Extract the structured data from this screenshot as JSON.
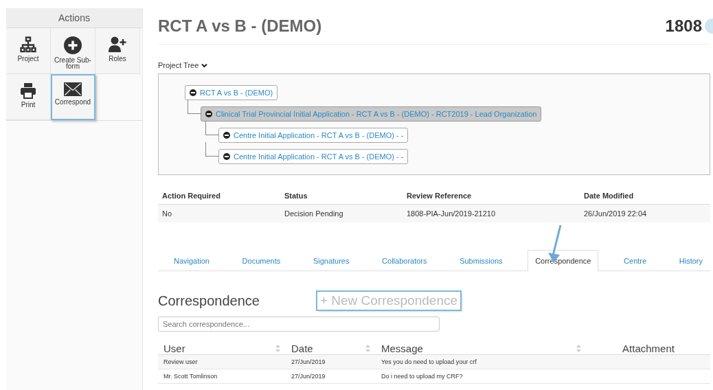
{
  "sidebar": {
    "title": "Actions",
    "actions": [
      {
        "label": "Project",
        "kind": "hierarchy",
        "highlighted": false
      },
      {
        "label": "Create Sub-form",
        "kind": "plus",
        "highlighted": false
      },
      {
        "label": "Roles",
        "kind": "adduser",
        "highlighted": false
      },
      {
        "label": "Print",
        "kind": "printer",
        "highlighted": false
      },
      {
        "label": "Correspond",
        "kind": "envelope",
        "highlighted": true
      }
    ]
  },
  "header": {
    "title": "RCT A vs B - (DEMO)",
    "number": "1808"
  },
  "project_tree": {
    "label": "Project Tree",
    "nodes": [
      {
        "label": "RCT A vs B - (DEMO)",
        "selected": false,
        "children": [
          {
            "label": "Clinical Trial Provincial Initial Application - RCT A vs B - (DEMO) - RCT2019 - Lead Organization",
            "selected": true,
            "children": [
              {
                "label": "Centre Initial Application - RCT A vs B - (DEMO) - -",
                "selected": false
              },
              {
                "label": "Centre Initial Application - RCT A vs B - (DEMO) - -",
                "selected": false
              }
            ]
          }
        ]
      }
    ]
  },
  "summary": {
    "columns": [
      "Action Required",
      "Status",
      "Review Reference",
      "Date Modified"
    ],
    "row": [
      "No",
      "Decision Pending",
      "1808-PIA-Jun/2019-21210",
      "26/Jun/2019 22:04"
    ]
  },
  "tabs": [
    {
      "label": "Navigation",
      "selected": false
    },
    {
      "label": "Documents",
      "selected": false
    },
    {
      "label": "Signatures",
      "selected": false
    },
    {
      "label": "Collaborators",
      "selected": false
    },
    {
      "label": "Submissions",
      "selected": false
    },
    {
      "label": "Correspondence",
      "selected": true
    },
    {
      "label": "Centre",
      "selected": false
    },
    {
      "label": "History",
      "selected": false
    }
  ],
  "correspondence": {
    "title": "Correspondence",
    "new_button": {
      "label": "+ New Correspondence",
      "highlighted": true
    },
    "search": {
      "placeholder": "Search correspondence..."
    },
    "columns": [
      {
        "label": "User",
        "sortable": true
      },
      {
        "label": "Date",
        "sortable": true
      },
      {
        "label": "Message",
        "sortable": true
      },
      {
        "label": "Attachment",
        "sortable": false
      }
    ],
    "rows": [
      [
        "Review user",
        "27/Jun/2019",
        "Yes you do need to upload your crf"
      ],
      [
        "Mr. Scott Tomlinson",
        "27/Jun/2019",
        "Do i need to upload my CRF?"
      ]
    ]
  }
}
